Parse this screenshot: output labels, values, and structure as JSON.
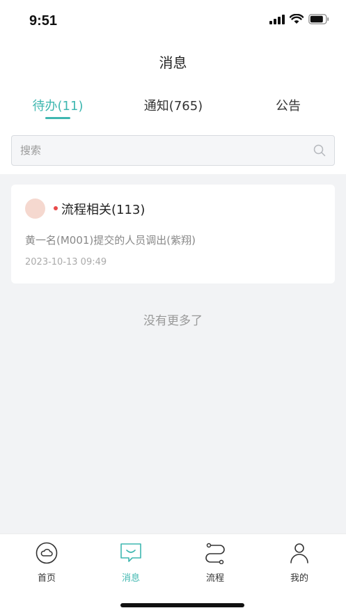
{
  "status_bar": {
    "time": "9:51"
  },
  "nav": {
    "title": "消息"
  },
  "tabs": [
    {
      "label": "待办(11)",
      "active": true
    },
    {
      "label": "通知(765)",
      "active": false
    },
    {
      "label": "公告",
      "active": false
    }
  ],
  "search": {
    "placeholder": "搜索",
    "icon": "search-icon"
  },
  "messages": [
    {
      "category": "流程相关(113)",
      "unread": true,
      "description": "黄一名(M001)提交的人员调出(紫翔)",
      "time": "2023-10-13 09:49"
    }
  ],
  "list_footer": "没有更多了",
  "tabbar": [
    {
      "label": "首页",
      "icon": "cloud-home-icon",
      "active": false
    },
    {
      "label": "消息",
      "icon": "message-icon",
      "active": true
    },
    {
      "label": "流程",
      "icon": "process-flow-icon",
      "active": false
    },
    {
      "label": "我的",
      "icon": "user-icon",
      "active": false
    }
  ],
  "colors": {
    "accent": "#3fb7b0",
    "unread_dot": "#e84a4a",
    "avatar": "#f5d8cf",
    "background": "#f2f3f5"
  }
}
